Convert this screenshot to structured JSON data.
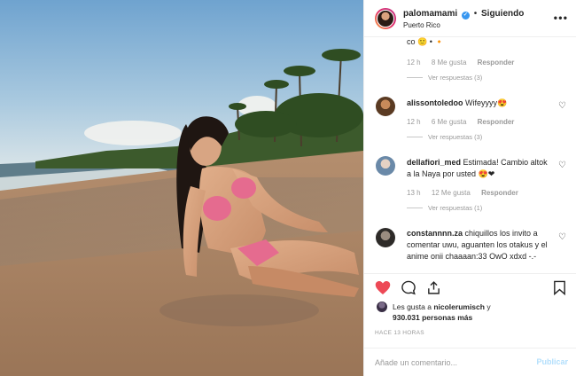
{
  "header": {
    "username": "palomamami",
    "verified_icon": "verified-badge-icon",
    "separator": "•",
    "follow_status": "Siguiendo",
    "location": "Puerto Rico",
    "more_icon": "more-options-icon"
  },
  "comments": {
    "top_partial": {
      "text": "co 🙂 • 🔸",
      "time": "12 h",
      "likes": "8 Me gusta",
      "reply": "Responder",
      "view_replies": "Ver respuestas (3)"
    },
    "items": [
      {
        "username": "alissontoledoo",
        "text": "Wifeyyyy😍",
        "time": "12 h",
        "likes": "6 Me gusta",
        "reply": "Responder",
        "view_replies": "Ver respuestas (3)"
      },
      {
        "username": "dellafiori_med",
        "text": "Estimada! Cambio altok a la Naya por usted 😍❤",
        "time": "13 h",
        "likes": "12 Me gusta",
        "reply": "Responder",
        "view_replies": "Ver respuestas (1)"
      },
      {
        "username": "constannnn.za",
        "text": "chiquillos los invito a comentar uwu, aguanten los otakus y el anime onii chaaaan:33 OwO xdxd -.-"
      }
    ]
  },
  "actions": {
    "like_icon": "heart-filled-icon",
    "comment_icon": "comment-icon",
    "share_icon": "share-icon",
    "save_icon": "bookmark-icon"
  },
  "likes": {
    "prefix": "Les gusta a",
    "user": "nicolerumisch",
    "conj": "y",
    "count": "930.031 personas más"
  },
  "time_ago": "HACE 13 HORAS",
  "add_comment": {
    "placeholder": "Añade un comentario...",
    "publish": "Publicar"
  },
  "colors": {
    "like_red": "#ed4956",
    "verified_blue": "#3897f0",
    "publish_disabled": "#b2dffc",
    "muted_text": "#999999"
  }
}
